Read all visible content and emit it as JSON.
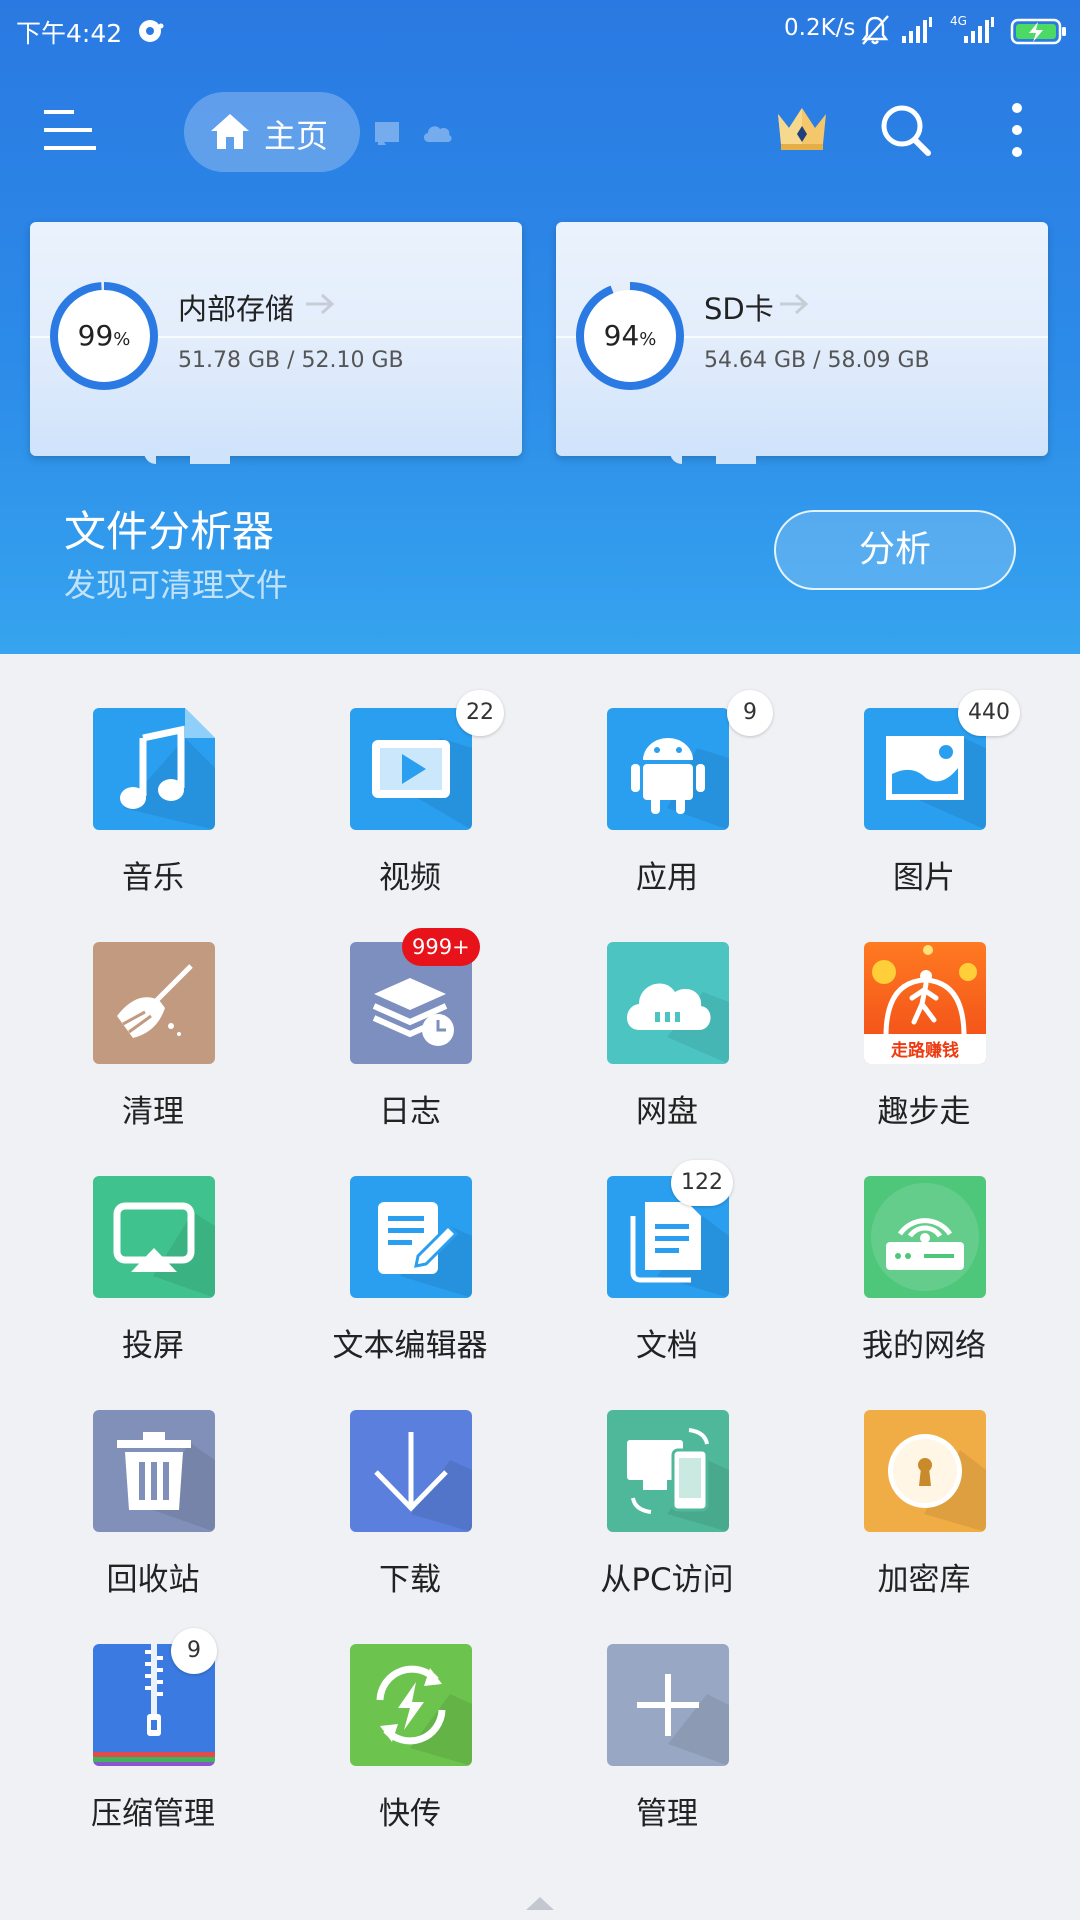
{
  "status_bar": {
    "time": "下午4:42",
    "net_speed": "0.2K/s",
    "network_type": "4G"
  },
  "toolbar": {
    "home_label": "主页"
  },
  "storage": [
    {
      "name": "内部存储",
      "percent": "99",
      "percent_unit": "%",
      "used": "51.78 GB / 52.10 GB",
      "fill": 0.99
    },
    {
      "name": "SD卡",
      "percent": "94",
      "percent_unit": "%",
      "used": "54.64 GB / 58.09 GB",
      "fill": 0.94
    }
  ],
  "analyzer": {
    "title": "文件分析器",
    "subtitle": "发现可清理文件",
    "button": "分析"
  },
  "tiles": [
    {
      "label": "音乐",
      "icon": "music-icon",
      "badge": ""
    },
    {
      "label": "视频",
      "icon": "video-icon",
      "badge": "22"
    },
    {
      "label": "应用",
      "icon": "android-icon",
      "badge": "9"
    },
    {
      "label": "图片",
      "icon": "image-icon",
      "badge": "440"
    },
    {
      "label": "清理",
      "icon": "broom-icon",
      "badge": ""
    },
    {
      "label": "日志",
      "icon": "log-icon",
      "badge": "999+"
    },
    {
      "label": "网盘",
      "icon": "cloud-drive-icon",
      "badge": ""
    },
    {
      "label": "趣步走",
      "icon": "walk-earn-icon",
      "badge": "",
      "icon_caption": "走路赚钱"
    },
    {
      "label": "投屏",
      "icon": "cast-screen-icon",
      "badge": ""
    },
    {
      "label": "文本编辑器",
      "icon": "text-editor-icon",
      "badge": ""
    },
    {
      "label": "文档",
      "icon": "document-icon",
      "badge": "122"
    },
    {
      "label": "我的网络",
      "icon": "network-icon",
      "badge": ""
    },
    {
      "label": "回收站",
      "icon": "trash-icon",
      "badge": ""
    },
    {
      "label": "下载",
      "icon": "download-icon",
      "badge": ""
    },
    {
      "label": "从PC访问",
      "icon": "pc-access-icon",
      "badge": ""
    },
    {
      "label": "加密库",
      "icon": "vault-icon",
      "badge": ""
    },
    {
      "label": "压缩管理",
      "icon": "zip-icon",
      "badge": "9"
    },
    {
      "label": "快传",
      "icon": "quick-transfer-icon",
      "badge": ""
    },
    {
      "label": "管理",
      "icon": "add-manage-icon",
      "badge": ""
    }
  ]
}
